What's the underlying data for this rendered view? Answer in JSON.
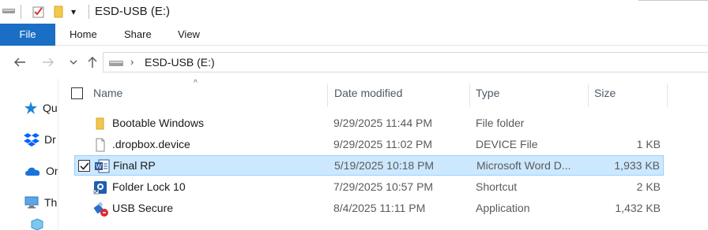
{
  "window": {
    "title": "ESD-USB (E:)"
  },
  "ribbon": {
    "tabs": [
      {
        "label": "File"
      },
      {
        "label": "Home"
      },
      {
        "label": "Share"
      },
      {
        "label": "View"
      }
    ]
  },
  "address": {
    "path": "ESD-USB (E:)"
  },
  "navpane": {
    "items": [
      {
        "label": "Qu",
        "icon": "star-icon"
      },
      {
        "label": "Dr",
        "icon": "dropbox-icon"
      },
      {
        "label": "On",
        "icon": "onedrive-cloud-icon"
      },
      {
        "label": "Th",
        "icon": "computer-icon"
      }
    ]
  },
  "filelist": {
    "columns": {
      "name": "Name",
      "date": "Date modified",
      "type": "Type",
      "size": "Size"
    },
    "rows": [
      {
        "name": "Bootable Windows",
        "date": "9/29/2025 11:44 PM",
        "type": "File folder",
        "size": "",
        "icon": "folder-icon",
        "selected": false
      },
      {
        "name": ".dropbox.device",
        "date": "9/29/2025 11:02 PM",
        "type": "DEVICE File",
        "size": "1 KB",
        "icon": "generic-file-icon",
        "selected": false
      },
      {
        "name": "Final RP",
        "date": "5/19/2025 10:18 PM",
        "type": "Microsoft Word D...",
        "size": "1,933 KB",
        "icon": "word-document-icon",
        "selected": true
      },
      {
        "name": "Folder Lock 10",
        "date": "7/29/2025 10:57 PM",
        "type": "Shortcut",
        "size": "2 KB",
        "icon": "folder-lock-shortcut-icon",
        "selected": false
      },
      {
        "name": "USB Secure",
        "date": "8/4/2025 11:11 PM",
        "type": "Application",
        "size": "1,432 KB",
        "icon": "usb-secure-app-icon",
        "selected": false
      }
    ]
  },
  "colors": {
    "accent": "#1a6fc4",
    "selection_bg": "#cce8ff",
    "selection_border": "#99d1ff"
  }
}
